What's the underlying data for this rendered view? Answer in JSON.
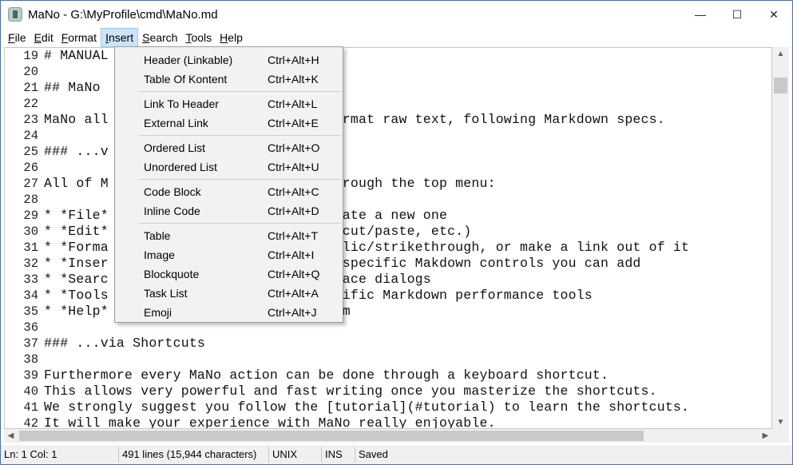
{
  "window": {
    "title": "MaNo - G:\\MyProfile\\cmd\\MaNo.md",
    "controls": {
      "minimize": "—",
      "maximize": "☐",
      "close": "✕"
    }
  },
  "menubar": {
    "items": [
      {
        "label": "File",
        "accel": "F",
        "rest": "ile",
        "active": false
      },
      {
        "label": "Edit",
        "accel": "E",
        "rest": "dit",
        "active": false
      },
      {
        "label": "Format",
        "accel": "F",
        "rest": "ormat",
        "active": false
      },
      {
        "label": "Insert",
        "accel": "I",
        "rest": "nsert",
        "active": true
      },
      {
        "label": "Search",
        "accel": "S",
        "rest": "earch",
        "active": false
      },
      {
        "label": "Tools",
        "accel": "T",
        "rest": "ools",
        "active": false
      },
      {
        "label": "Help",
        "accel": "H",
        "rest": "elp",
        "active": false
      }
    ]
  },
  "editor": {
    "lines": [
      {
        "n": "19",
        "text": "# MANUAL"
      },
      {
        "n": "20",
        "text": ""
      },
      {
        "n": "21",
        "text": "## MaNo"
      },
      {
        "n": "22",
        "text": ""
      },
      {
        "n": "23",
        "text": "MaNo all                           format raw text, following Markdown specs."
      },
      {
        "n": "24",
        "text": ""
      },
      {
        "n": "25",
        "text": "### ...v"
      },
      {
        "n": "26",
        "text": ""
      },
      {
        "n": "27",
        "text": "All of M                         d through the top menu:"
      },
      {
        "n": "28",
        "text": ""
      },
      {
        "n": "29",
        "text": "* *File*                          create a new one"
      },
      {
        "n": "30",
        "text": "* *Edit*                          py/cut/paste, etc.)"
      },
      {
        "n": "31",
        "text": "* *Forma                          italic/strikethrough, or make a link out of it"
      },
      {
        "n": "32",
        "text": "* *Inser                          he specific Makdown controls you can add"
      },
      {
        "n": "33",
        "text": "* *Searc                          eplace dialogs"
      },
      {
        "n": "34",
        "text": "* *Tools                          pecific Markdown performance tools"
      },
      {
        "n": "35",
        "text": "* *Help*                          gram"
      },
      {
        "n": "36",
        "text": ""
      },
      {
        "n": "37",
        "text": "### ...via Shortcuts"
      },
      {
        "n": "38",
        "text": ""
      },
      {
        "n": "39",
        "text": "Furthermore every MaNo action can be done through a keyboard shortcut."
      },
      {
        "n": "40",
        "text": "This allows very powerful and fast writing once you masterize the shortcuts."
      },
      {
        "n": "41",
        "text": "We strongly suggest you follow the [tutorial](#tutorial) to learn the shortcuts."
      },
      {
        "n": "42",
        "text": "It will make your experience with MaNo really enjoyable."
      }
    ]
  },
  "insert_menu": {
    "groups": [
      [
        {
          "label": "Header (Linkable)",
          "shortcut": "Ctrl+Alt+H"
        },
        {
          "label": "Table Of Kontent",
          "shortcut": "Ctrl+Alt+K"
        }
      ],
      [
        {
          "label": "Link To Header",
          "shortcut": "Ctrl+Alt+L"
        },
        {
          "label": "External Link",
          "shortcut": "Ctrl+Alt+E"
        }
      ],
      [
        {
          "label": "Ordered List",
          "shortcut": "Ctrl+Alt+O"
        },
        {
          "label": "Unordered List",
          "shortcut": "Ctrl+Alt+U"
        }
      ],
      [
        {
          "label": "Code Block",
          "shortcut": "Ctrl+Alt+C"
        },
        {
          "label": "Inline Code",
          "shortcut": "Ctrl+Alt+D"
        }
      ],
      [
        {
          "label": "Table",
          "shortcut": "Ctrl+Alt+T"
        },
        {
          "label": "Image",
          "shortcut": "Ctrl+Alt+I"
        },
        {
          "label": "Blockquote",
          "shortcut": "Ctrl+Alt+Q"
        },
        {
          "label": "Task List",
          "shortcut": "Ctrl+Alt+A"
        },
        {
          "label": "Emoji",
          "shortcut": "Ctrl+Alt+J"
        }
      ]
    ]
  },
  "statusbar": {
    "cursor": "Ln: 1 Col: 1",
    "spacer": "",
    "stats": "491 lines (15,944 characters)",
    "eol": "UNIX",
    "mode": "INS",
    "state": "Saved"
  },
  "colors": {
    "menu_active_bg": "#cce4f7",
    "desktop_bg": "#0a2a66"
  }
}
